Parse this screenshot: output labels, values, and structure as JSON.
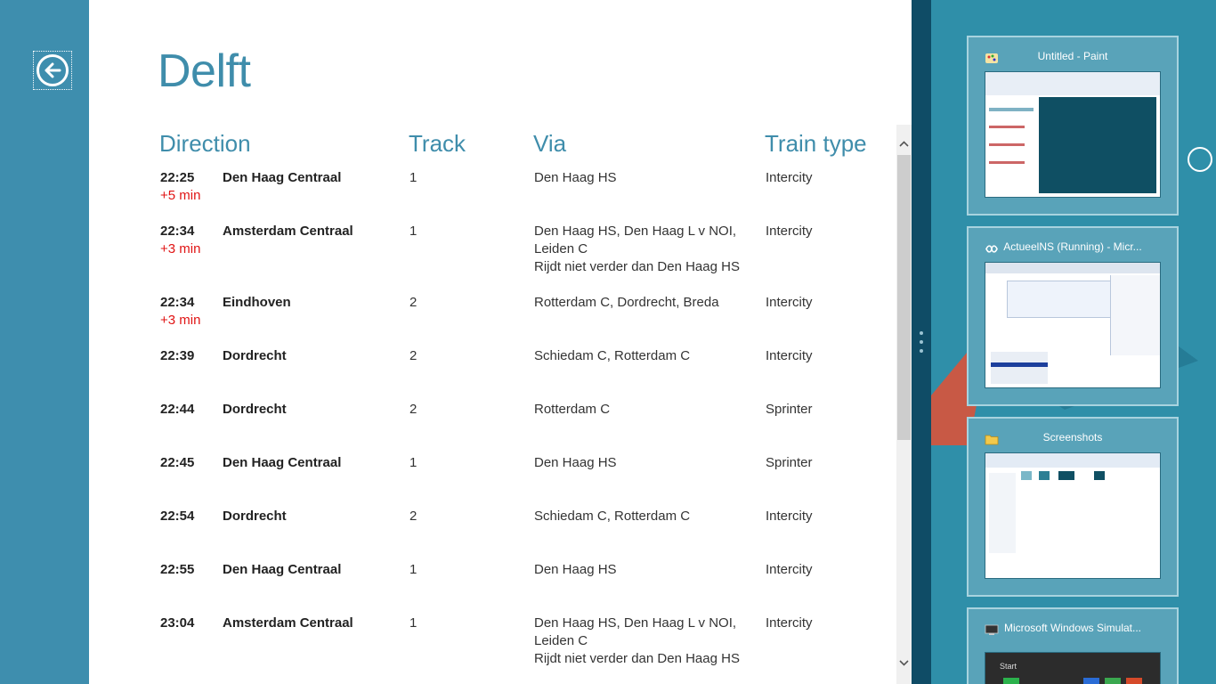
{
  "page": {
    "title": "Delft",
    "headers": {
      "direction": "Direction",
      "track": "Track",
      "via": "Via",
      "train_type": "Train type"
    }
  },
  "departures": [
    {
      "time": "22:25",
      "delay": "+5 min",
      "destination": "Den Haag Centraal",
      "track": "1",
      "via": "Den Haag HS",
      "note": "",
      "type": "Intercity"
    },
    {
      "time": "22:34",
      "delay": "+3 min",
      "destination": "Amsterdam Centraal",
      "track": "1",
      "via": "Den Haag HS, Den Haag L v NOI, Leiden C",
      "note": "Rijdt niet verder dan  Den Haag HS",
      "type": "Intercity"
    },
    {
      "time": "22:34",
      "delay": "+3 min",
      "destination": "Eindhoven",
      "track": "2",
      "via": "Rotterdam C, Dordrecht, Breda",
      "note": "",
      "type": "Intercity"
    },
    {
      "time": "22:39",
      "delay": "",
      "destination": "Dordrecht",
      "track": "2",
      "via": "Schiedam C, Rotterdam C",
      "note": "",
      "type": "Intercity"
    },
    {
      "time": "22:44",
      "delay": "",
      "destination": "Dordrecht",
      "track": "2",
      "via": "Rotterdam C",
      "note": "",
      "type": "Sprinter"
    },
    {
      "time": "22:45",
      "delay": "",
      "destination": "Den Haag Centraal",
      "track": "1",
      "via": "Den Haag HS",
      "note": "",
      "type": "Sprinter"
    },
    {
      "time": "22:54",
      "delay": "",
      "destination": "Dordrecht",
      "track": "2",
      "via": "Schiedam C, Rotterdam C",
      "note": "",
      "type": "Intercity"
    },
    {
      "time": "22:55",
      "delay": "",
      "destination": "Den Haag Centraal",
      "track": "1",
      "via": "Den Haag HS",
      "note": "",
      "type": "Intercity"
    },
    {
      "time": "23:04",
      "delay": "",
      "destination": "Amsterdam Centraal",
      "track": "1",
      "via": "Den Haag HS, Den Haag L v NOI, Leiden C",
      "note": "Rijdt niet verder dan  Den Haag HS",
      "type": "Intercity"
    }
  ],
  "switcher": {
    "apps": [
      {
        "title": "Untitled - Paint",
        "icon": "paint-icon"
      },
      {
        "title": "ActueelNS (Running) - Micr...",
        "icon": "visual-studio-icon"
      },
      {
        "title": "Screenshots",
        "icon": "folder-icon"
      },
      {
        "title": "Microsoft Windows Simulat...",
        "icon": "simulator-icon"
      }
    ],
    "simulator_start_label": "Start"
  },
  "colors": {
    "accent": "#3f8dab",
    "delay": "#e01414",
    "background": "#3a8bab"
  }
}
